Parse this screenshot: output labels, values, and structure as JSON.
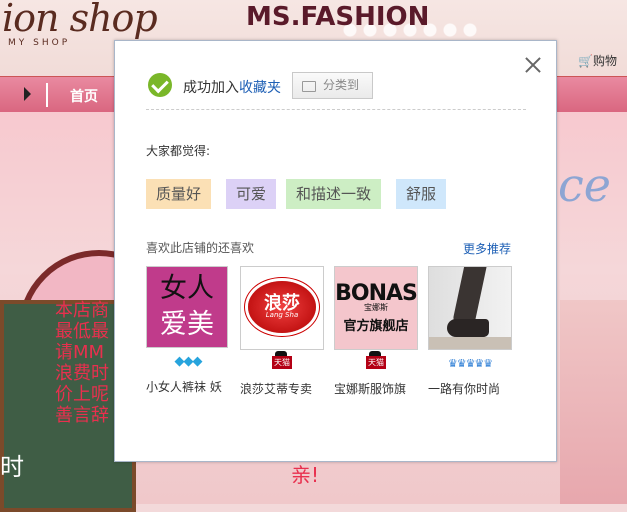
{
  "page": {
    "logo_script": "ion shop",
    "logo_sub": "MY SHOP",
    "brand": "MS.FASHION",
    "cart_label": "购物",
    "nav": {
      "home": "首页"
    },
    "banner_partial_text": "ce",
    "board_text": "本店商\n最低最\n请MM\n浪费时\n价上呢\n善言辞",
    "board_bottom_text": "时",
    "bottom_text": "亲!"
  },
  "dialog": {
    "success_prefix": "成功加入",
    "success_link": "收藏夹",
    "classify_button": "分类到",
    "feel_title": "大家都觉得:",
    "tags": [
      {
        "label": "质量好",
        "color": "#fbe0b5"
      },
      {
        "label": "可爱",
        "color": "#dcd1f6"
      },
      {
        "label": "和描述一致",
        "color": "#cdeec4"
      },
      {
        "label": "舒服",
        "color": "#cfe7fb"
      }
    ],
    "also_like_title": "喜欢此店铺的还喜欢",
    "more_link": "更多推荐",
    "products": [
      {
        "name": "小女人裤袜 妖",
        "badge": "◆◆◆",
        "badge_type": "diamond",
        "image": {
          "line1": "女人",
          "line2": "爱美"
        }
      },
      {
        "name": "浪莎艾蒂专卖",
        "badge": "天猫",
        "badge_type": "tmall",
        "image": {
          "logo": "浪莎",
          "sub": "Lang Sha"
        }
      },
      {
        "name": "宝娜斯服饰旗",
        "badge": "天猫",
        "badge_type": "tmall",
        "image": {
          "brand": "BONAS",
          "cn": "宝娜斯",
          "label": "官方旗舰店"
        }
      },
      {
        "name": "一路有你时尚",
        "badge": "♛♛♛♛♛",
        "badge_type": "crown",
        "image": {}
      }
    ]
  }
}
